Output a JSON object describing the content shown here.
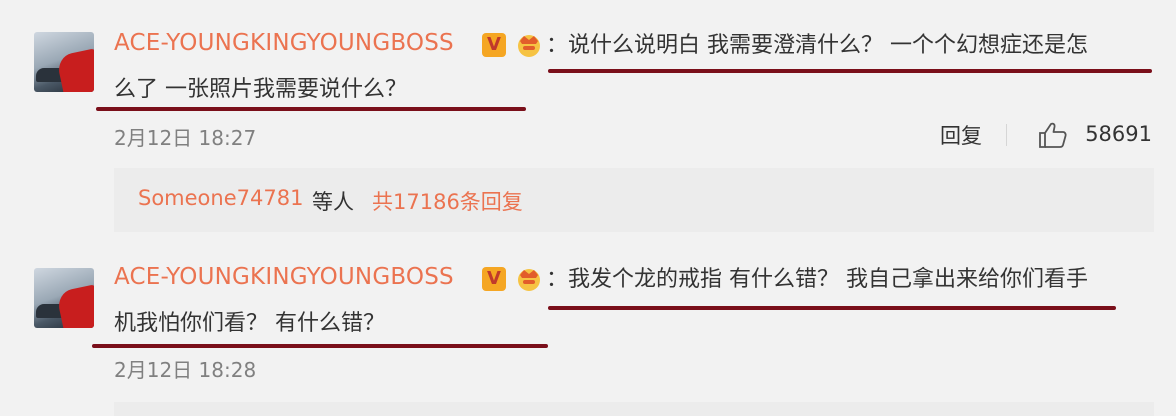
{
  "comments": [
    {
      "username": "ACE-YOUNGKINGYOUNGBOSS",
      "badge": "V",
      "colon": "：",
      "line1": "说什么说明白 我需要澄清什么？ 一个个幻想症还是怎",
      "line2": "么了 一张照片我需要说什么？",
      "time": "2月12日 18:27",
      "reply_label": "回复",
      "like_count": "58691",
      "reply_summary": {
        "user": "Someone74781",
        "middle": "等人",
        "total": "共17186条回复"
      }
    },
    {
      "username": "ACE-YOUNGKINGYOUNGBOSS",
      "badge": "V",
      "colon": "：",
      "line1": "我发个龙的戒指 有什么错？ 我自己拿出来给你们看手",
      "line2": "机我怕你们看？ 有什么错？",
      "time": "2月12日 18:28"
    }
  ],
  "colors": {
    "username": "#eb7350",
    "underline": "#7a0f1a",
    "background": "#f2f2f2"
  },
  "icons": [
    "avatar",
    "verified-v-badge",
    "crown-icon",
    "thumbs-up-icon"
  ]
}
